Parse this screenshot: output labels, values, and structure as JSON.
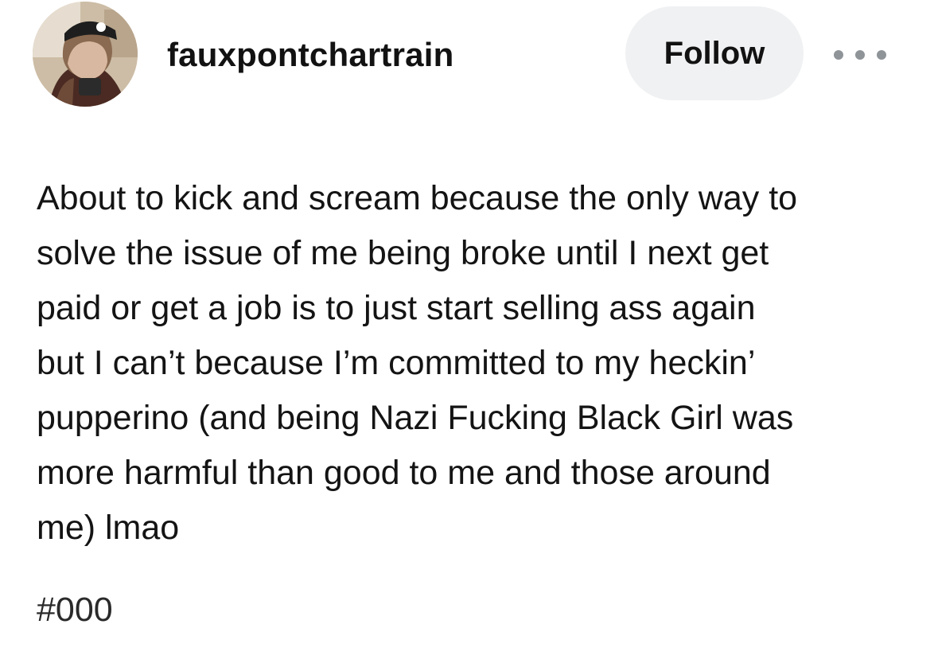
{
  "post": {
    "username": "fauxpontchartrain",
    "follow_label": "Follow",
    "more_icon": "more-horizontal-icon",
    "avatar_icon": "user-avatar-photo",
    "body_lines": [
      "About to kick and scream because the only way to",
      "solve the issue of me being broke until I next get",
      "paid or get a job is to just start selling ass again",
      "but I can’t because I’m committed to my heckin’",
      "pupperino (and being Nazi Fucking Black Girl was",
      "more harmful than good to me and those around",
      "me) lmao"
    ],
    "tag": "#000"
  },
  "colors": {
    "follow_bg": "#f0f1f2",
    "text": "#141414",
    "dots": "#8f9499"
  }
}
